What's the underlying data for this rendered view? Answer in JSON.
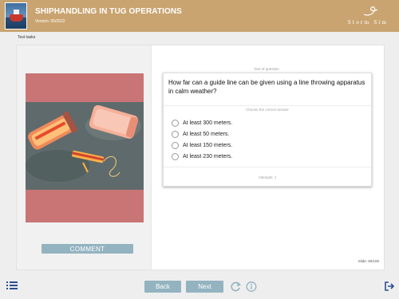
{
  "header": {
    "title": "SHIPHANDLING IN TUG OPERATIONS",
    "version": "Version: 05/2022",
    "brand": "Storm Sim",
    "logo_icon": "tugboat-logo"
  },
  "breadcrumb": "Test tasks",
  "panel": {
    "image_icon": "line-throwing-apparatus-photo",
    "comment_label": "COMMENT"
  },
  "question": {
    "section_label": "Text of question",
    "text": "How far can a guide line can be given using a line throwing apparatus in calm weather?",
    "instruction": "Choose the correct answer",
    "options": [
      {
        "label": "At least 300 meters."
      },
      {
        "label": "At least 50 meters."
      },
      {
        "label": "At least 150 meters."
      },
      {
        "label": "At least 230 meters."
      }
    ],
    "attempts": "Attempts: 1"
  },
  "slide_counter": "Slide: 60/106",
  "footer": {
    "back_label": "Back",
    "next_label": "Next",
    "menu_icon": "list-menu-icon",
    "reload_icon": "reload-icon",
    "info_icon": "info-icon",
    "exit_icon": "exit-icon"
  },
  "colors": {
    "header_bg": "#c9a470",
    "button_bg": "#93b3c0",
    "photo_overlay": "#c97575",
    "icon_color": "#2e4d8f"
  }
}
